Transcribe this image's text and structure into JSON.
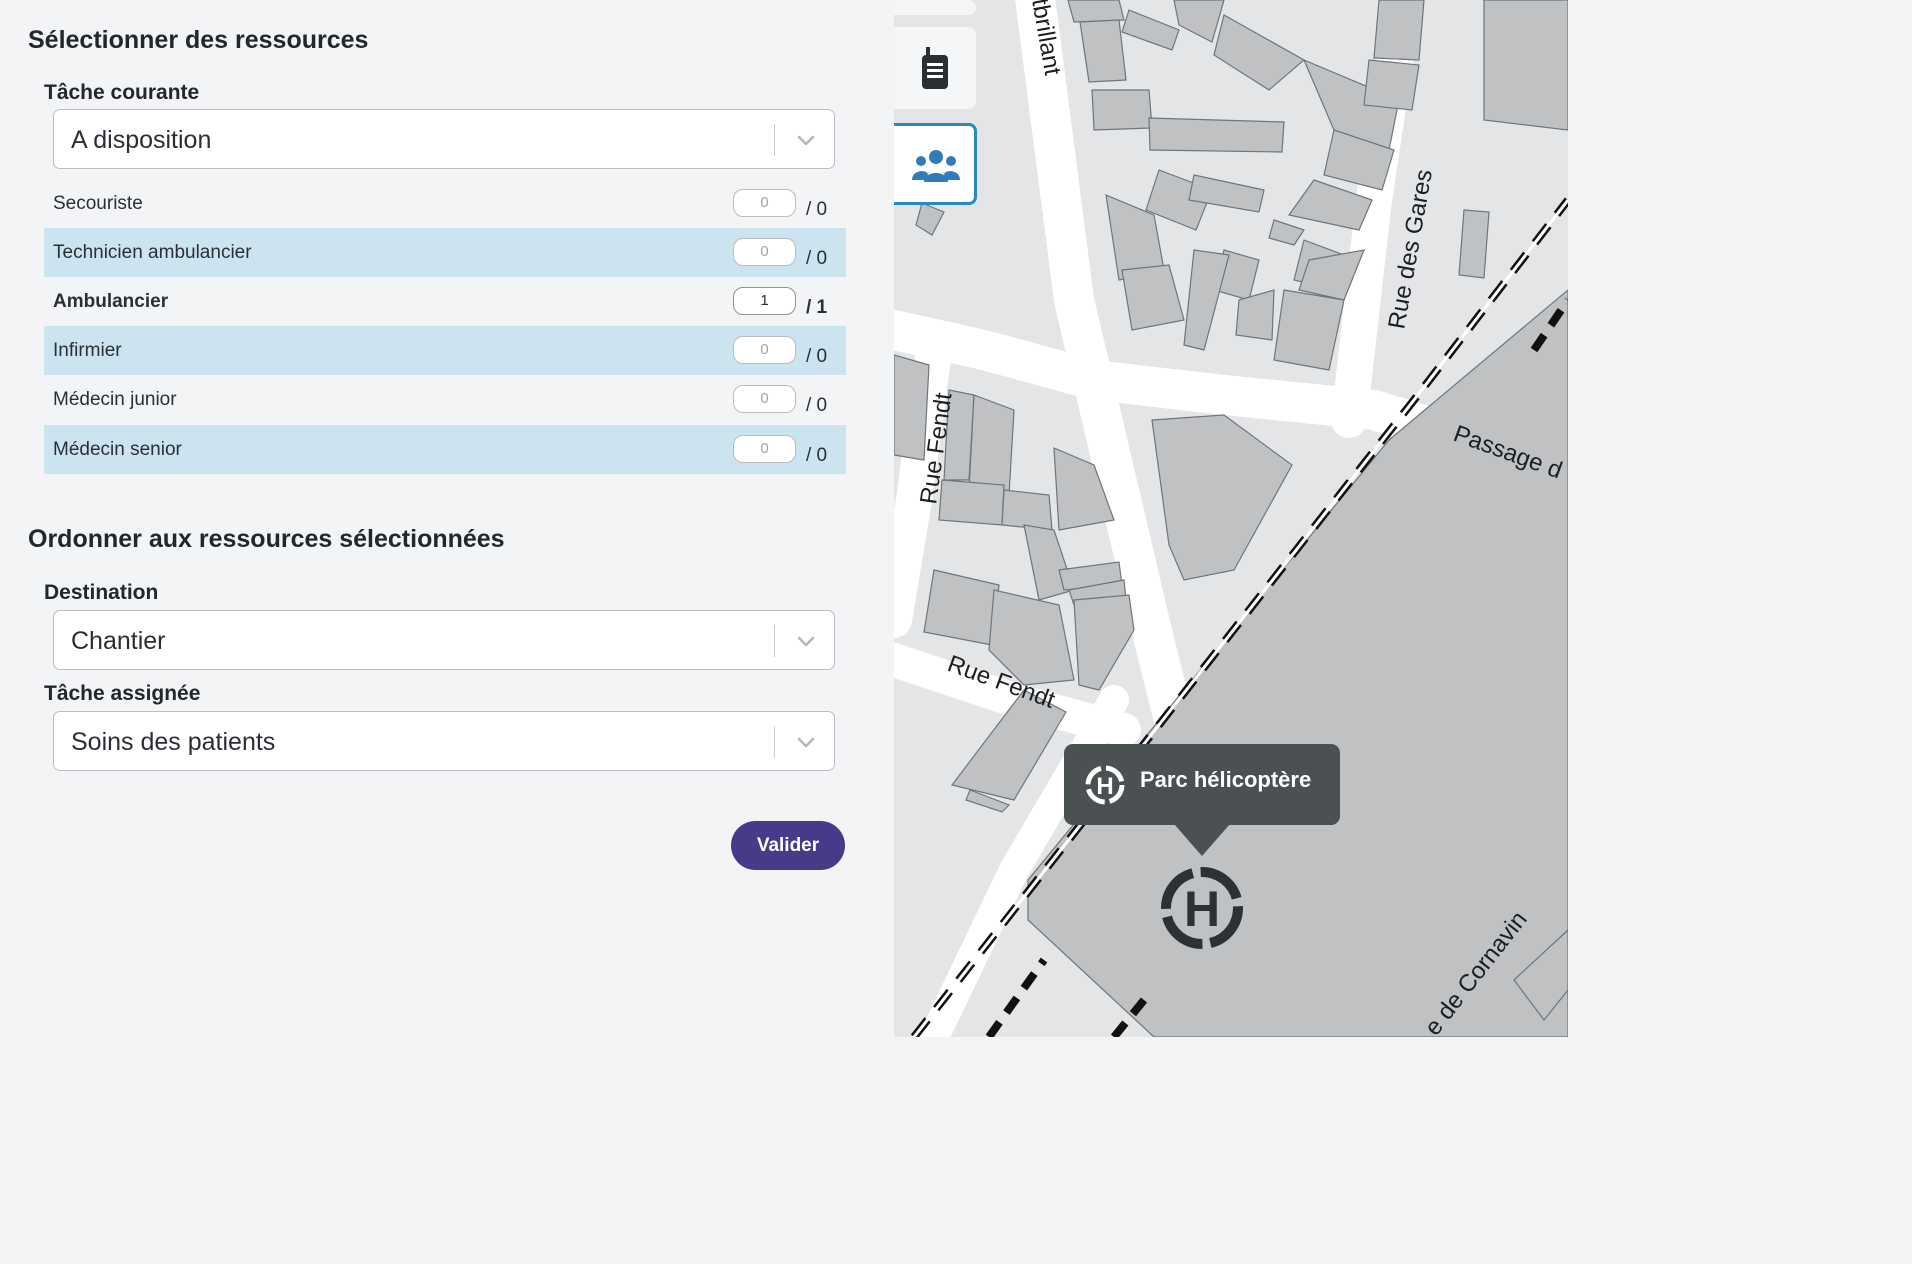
{
  "select_section": {
    "title": "Sélectionner des ressources",
    "current_task_label": "Tâche courante",
    "current_task_value": "A disposition",
    "resources": [
      {
        "name": "Secouriste",
        "count": "0",
        "total": "/ 0"
      },
      {
        "name": "Technicien ambulancier",
        "count": "0",
        "total": "/ 0"
      },
      {
        "name": "Ambulancier",
        "count": "1",
        "total": "/ 1"
      },
      {
        "name": "Infirmier",
        "count": "0",
        "total": "/ 0"
      },
      {
        "name": "Médecin junior",
        "count": "0",
        "total": "/ 0"
      },
      {
        "name": "Médecin senior",
        "count": "0",
        "total": "/ 0"
      }
    ]
  },
  "order_section": {
    "title": "Ordonner aux ressources sélectionnées",
    "destination_label": "Destination",
    "destination_value": "Chantier",
    "assigned_task_label": "Tâche assignée",
    "assigned_task_value": "Soins des patients",
    "submit_label": "Valider"
  },
  "map": {
    "streets": [
      "tbrillant",
      "Rue des Gares",
      "Rue Fendt",
      "Rue Fendt",
      "Passage d",
      "e de Cornavin"
    ],
    "popup_label": "Parc hélicoptère",
    "tools": [
      {
        "icon": "radio-icon"
      },
      {
        "icon": "users-icon",
        "active": true
      }
    ]
  },
  "colors": {
    "accent": "#473a88",
    "row_highlight": "#cbe4ef",
    "active_tool_border": "#2d87c0",
    "popup_bg": "#4b5053"
  }
}
